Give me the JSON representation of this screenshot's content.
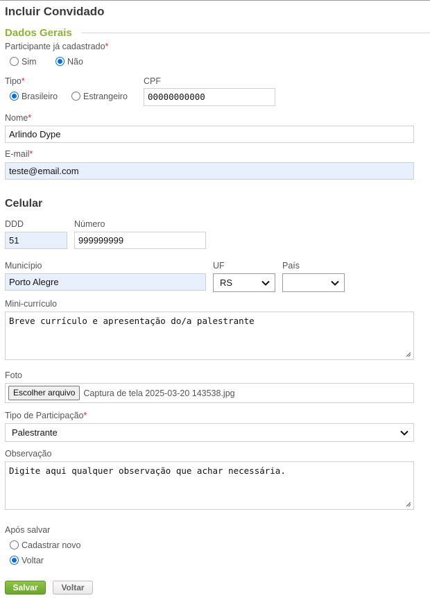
{
  "page_title": "Incluir Convidado",
  "section_legend": "Dados Gerais",
  "required_mark": "*",
  "participant": {
    "label": "Participante já cadastrado",
    "options": [
      "Sim",
      "Não"
    ],
    "selected": "Não"
  },
  "tipo": {
    "label": "Tipo",
    "options": [
      "Brasileiro",
      "Estrangeiro"
    ],
    "selected": "Brasileiro"
  },
  "cpf": {
    "label": "CPF",
    "value": "00000000000"
  },
  "nome": {
    "label": "Nome",
    "value": "Arlindo Dype"
  },
  "email": {
    "label": "E-mail",
    "value": "teste@email.com"
  },
  "celular": {
    "heading": "Celular",
    "ddd_label": "DDD",
    "ddd_value": "51",
    "numero_label": "Número",
    "numero_value": "999999999"
  },
  "municipio": {
    "label": "Município",
    "value": "Porto Alegre"
  },
  "uf": {
    "label": "UF",
    "value": "RS"
  },
  "pais": {
    "label": "País",
    "value": ""
  },
  "mini_curriculo": {
    "label": "Mini-currículo",
    "value": "Breve currículo e apresentação do/a palestrante"
  },
  "foto": {
    "label": "Foto",
    "button": "Escolher arquivo",
    "filename": "Captura de tela 2025-03-20 143538.jpg"
  },
  "tipo_participacao": {
    "label": "Tipo de Participação",
    "value": "Palestrante"
  },
  "observacao": {
    "label": "Observação",
    "value": "Digite aqui qualquer observação que achar necessária."
  },
  "apos_salvar": {
    "label": "Após salvar",
    "options": [
      "Cadastrar novo",
      "Voltar"
    ],
    "selected": "Voltar"
  },
  "buttons": {
    "save": "Salvar",
    "back": "Voltar"
  },
  "colors": {
    "accent_green": "#8db33a",
    "required_red": "#e0262c",
    "autofill_bg": "#e8f0fe",
    "radio_blue": "#0a6dd6"
  }
}
